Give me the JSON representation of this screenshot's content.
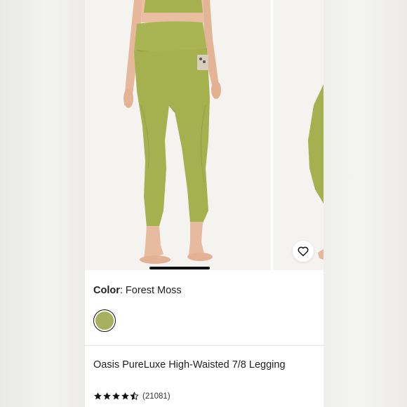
{
  "colors": {
    "accent": "#111111",
    "legging": "#a5b04f",
    "swatch": "#a7b05c",
    "skin": "#e8bba0"
  },
  "gallery": {
    "images": [
      "model wearing legging, front view",
      "model wearing legging, side view (partially visible)"
    ],
    "active_index": 0,
    "wishlist_icon": "heart-outline-icon"
  },
  "color_selector": {
    "label": "Color",
    "value": ": Forest Moss",
    "swatches": [
      {
        "color": "#a7b05c",
        "selected": true
      }
    ]
  },
  "product": {
    "title": "Oasis PureLuxe High-Waisted 7/8 Legging",
    "rating": 4.5,
    "review_count": "(21081)"
  }
}
